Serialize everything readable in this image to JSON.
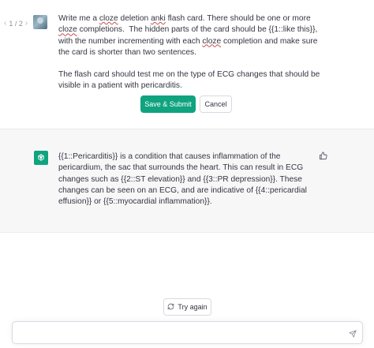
{
  "pager": {
    "prev": "‹",
    "label": "1 / 2",
    "next": "›"
  },
  "user_message": {
    "avatar_icon": "user-avatar-icon",
    "paragraph_1_parts": [
      "Write me a ",
      "cloze",
      " deletion ",
      "anki",
      " flash card. There should be one or more ",
      "cloze",
      " completions.  The hidden parts of the card should be {{1::like this}}, with the number incrementing with each ",
      "cloze",
      " completion and make sure the card is shorter than two sentences."
    ],
    "paragraph_2": "The flash card should test me on the type of ECG changes that should be visible in a patient with pericarditis."
  },
  "edit_actions": {
    "save_label": "Save & Submit",
    "cancel_label": "Cancel"
  },
  "assistant_message": {
    "logo_icon": "openai-logo-icon",
    "text": "{{1::Pericarditis}} is a condition that causes inflammation of the pericardium, the sac that surrounds the heart. This can result in ECG changes such as {{2::ST elevation}} and {{3::PR depression}}. These changes can be seen on an ECG, and are indicative of {{4::pericardial effusion}} or {{5::myocardial inflammation}}.",
    "feedback_icon": "thumbs-up-icon"
  },
  "try_again": {
    "label": "Try again",
    "icon": "refresh-icon"
  },
  "composer": {
    "value": "",
    "placeholder": "",
    "send_icon": "send-icon"
  },
  "colors": {
    "accent": "#10a37f",
    "assistant_bg": "#f7f7f8",
    "text": "#343541"
  }
}
